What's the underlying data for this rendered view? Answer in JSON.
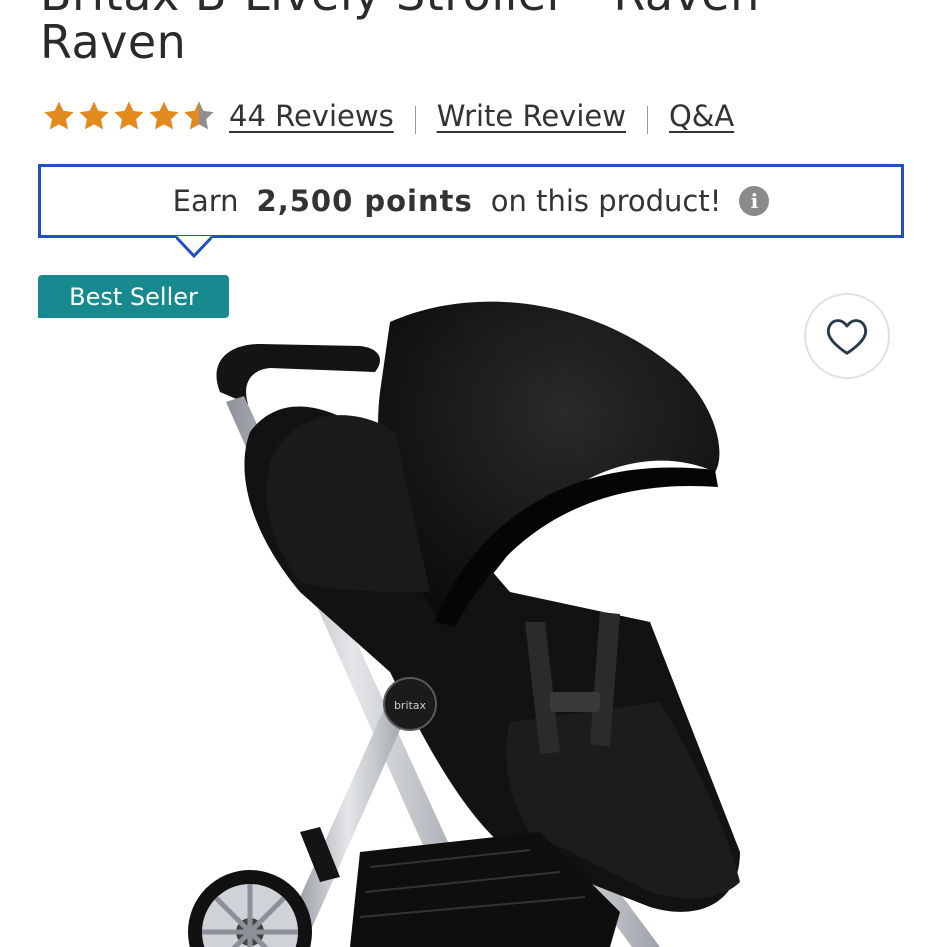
{
  "product": {
    "title_partial": "Britax B-Lively Stroller - Raven",
    "title_line2": "Raven"
  },
  "rating": {
    "value": 4.5,
    "max": 5,
    "reviews_label": "44 Reviews",
    "write_review_label": "Write Review",
    "qa_label": "Q&A"
  },
  "points": {
    "prefix": "Earn",
    "amount": "2,500 points",
    "suffix": "on this product!",
    "info_icon": "i"
  },
  "badge": {
    "label": "Best Seller"
  },
  "favorite": {
    "icon": "heart-outline-icon"
  },
  "image": {
    "brand_mark": "britax"
  },
  "colors": {
    "star": "#e38a1f",
    "star_empty": "#8f8f8f",
    "points_border": "#1f4fc2",
    "badge_bg": "#178a8f"
  }
}
